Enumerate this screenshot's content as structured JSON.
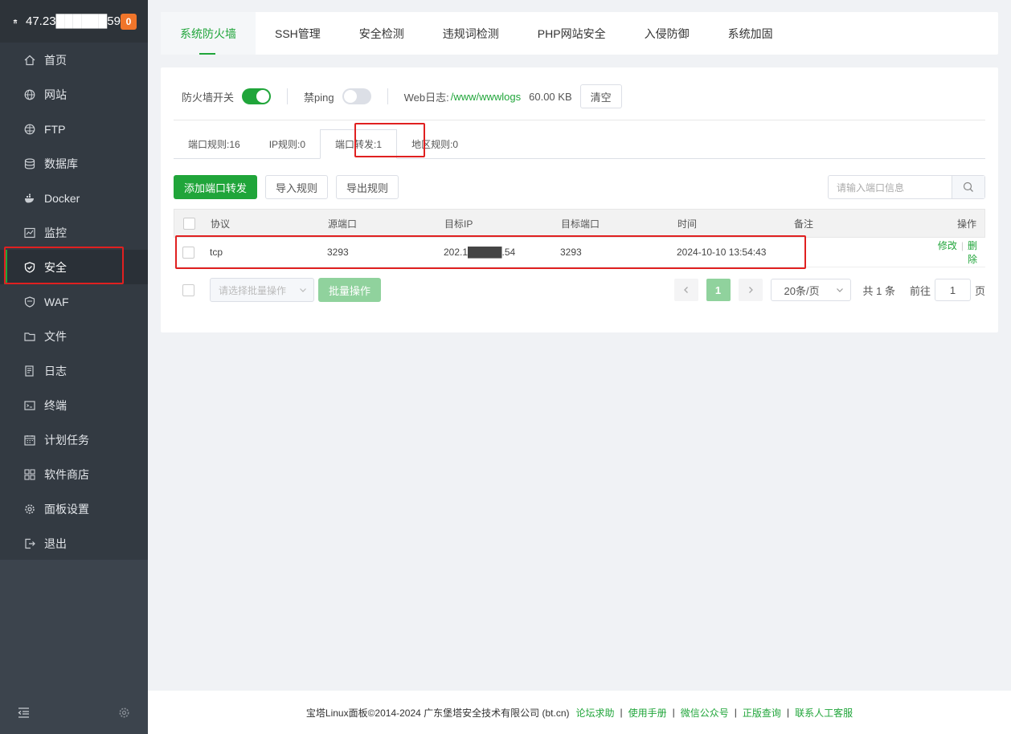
{
  "sidebar": {
    "server_ip": "47.23██████59",
    "badge": "0",
    "items": [
      {
        "label": "首页",
        "icon": "home-icon"
      },
      {
        "label": "网站",
        "icon": "globe-icon"
      },
      {
        "label": "FTP",
        "icon": "ftp-icon"
      },
      {
        "label": "数据库",
        "icon": "database-icon"
      },
      {
        "label": "Docker",
        "icon": "docker-icon"
      },
      {
        "label": "监控",
        "icon": "monitor-icon"
      },
      {
        "label": "安全",
        "icon": "shield-icon",
        "active": true
      },
      {
        "label": "WAF",
        "icon": "waf-icon"
      },
      {
        "label": "文件",
        "icon": "folder-icon"
      },
      {
        "label": "日志",
        "icon": "log-icon"
      },
      {
        "label": "终端",
        "icon": "terminal-icon"
      },
      {
        "label": "计划任务",
        "icon": "calendar-icon"
      },
      {
        "label": "软件商店",
        "icon": "apps-icon"
      },
      {
        "label": "面板设置",
        "icon": "gear-icon"
      },
      {
        "label": "退出",
        "icon": "logout-icon"
      }
    ]
  },
  "tabs": [
    "系统防火墙",
    "SSH管理",
    "安全检测",
    "违规词检测",
    "PHP网站安全",
    "入侵防御",
    "系统加固"
  ],
  "toolbar": {
    "firewall_label": "防火墙开关",
    "ping_label": "禁ping",
    "weblog_label": "Web日志:",
    "weblog_path": "/www/wwwlogs",
    "weblog_size": "60.00 KB",
    "clear_label": "清空"
  },
  "subtabs": [
    "端口规则:16",
    "IP规则:0",
    "端口转发:1",
    "地区规则:0"
  ],
  "actions": {
    "add": "添加端口转发",
    "import": "导入规则",
    "export": "导出规则",
    "search_placeholder": "请输入端口信息"
  },
  "table": {
    "headers": [
      "协议",
      "源端口",
      "目标IP",
      "目标端口",
      "时间",
      "备注",
      "操作"
    ],
    "rows": [
      {
        "protocol": "tcp",
        "src_port": "3293",
        "target_ip": "202.1█████.54",
        "target_port": "3293",
        "time": "2024-10-10 13:54:43",
        "note": "",
        "edit": "修改",
        "delete": "删除"
      }
    ]
  },
  "batch": {
    "select_placeholder": "请选择批量操作",
    "batch_label": "批量操作"
  },
  "pager": {
    "current": "1",
    "page_size": "20条/页",
    "total": "共 1 条",
    "goto": "前往",
    "goto_value": "1",
    "page_unit": "页"
  },
  "footer": {
    "copyright": "宝塔Linux面板©2014-2024 广东堡塔安全技术有限公司 (bt.cn)",
    "links": [
      "论坛求助",
      "使用手册",
      "微信公众号",
      "正版查询",
      "联系人工客服"
    ]
  },
  "colors": {
    "accent": "#20a53a",
    "highlight": "#e02020",
    "sidebar": "#333a42"
  }
}
